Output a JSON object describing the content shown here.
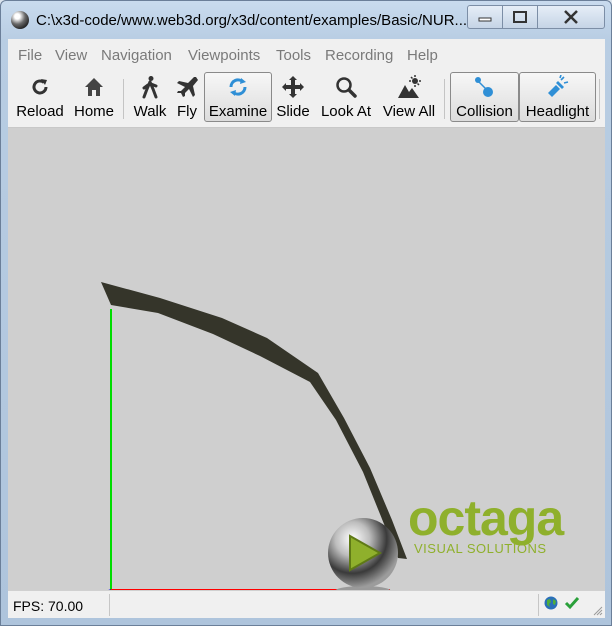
{
  "window": {
    "title": "C:\\x3d-code/www.web3d.org/x3d/content/examples/Basic/NUR...",
    "controls": {
      "minimize": "minimize",
      "maximize": "maximize",
      "close": "close"
    }
  },
  "menu": [
    "File",
    "View",
    "Navigation",
    "Viewpoints",
    "Tools",
    "Recording",
    "Help"
  ],
  "toolbar": {
    "reload": "Reload",
    "home": "Home",
    "walk": "Walk",
    "fly": "Fly",
    "examine": "Examine",
    "slide": "Slide",
    "look_at": "Look At",
    "view_all": "View All",
    "collision": "Collision",
    "headlight": "Headlight",
    "active_tools": [
      "Examine",
      "Collision",
      "Headlight"
    ]
  },
  "viewport": {
    "background_color": "#cfcfcf",
    "shape_color": "#35352a",
    "axis_colors": {
      "x": "#ff0000",
      "y": "#00dd00",
      "z": "#0000ff"
    },
    "logo": {
      "word": "octaga",
      "tagline": "VISUAL SOLUTIONS",
      "color": "#8fb02c"
    }
  },
  "status": {
    "fps": "FPS: 70.00",
    "icons": [
      "globe-icon",
      "checkmark-icon"
    ]
  }
}
